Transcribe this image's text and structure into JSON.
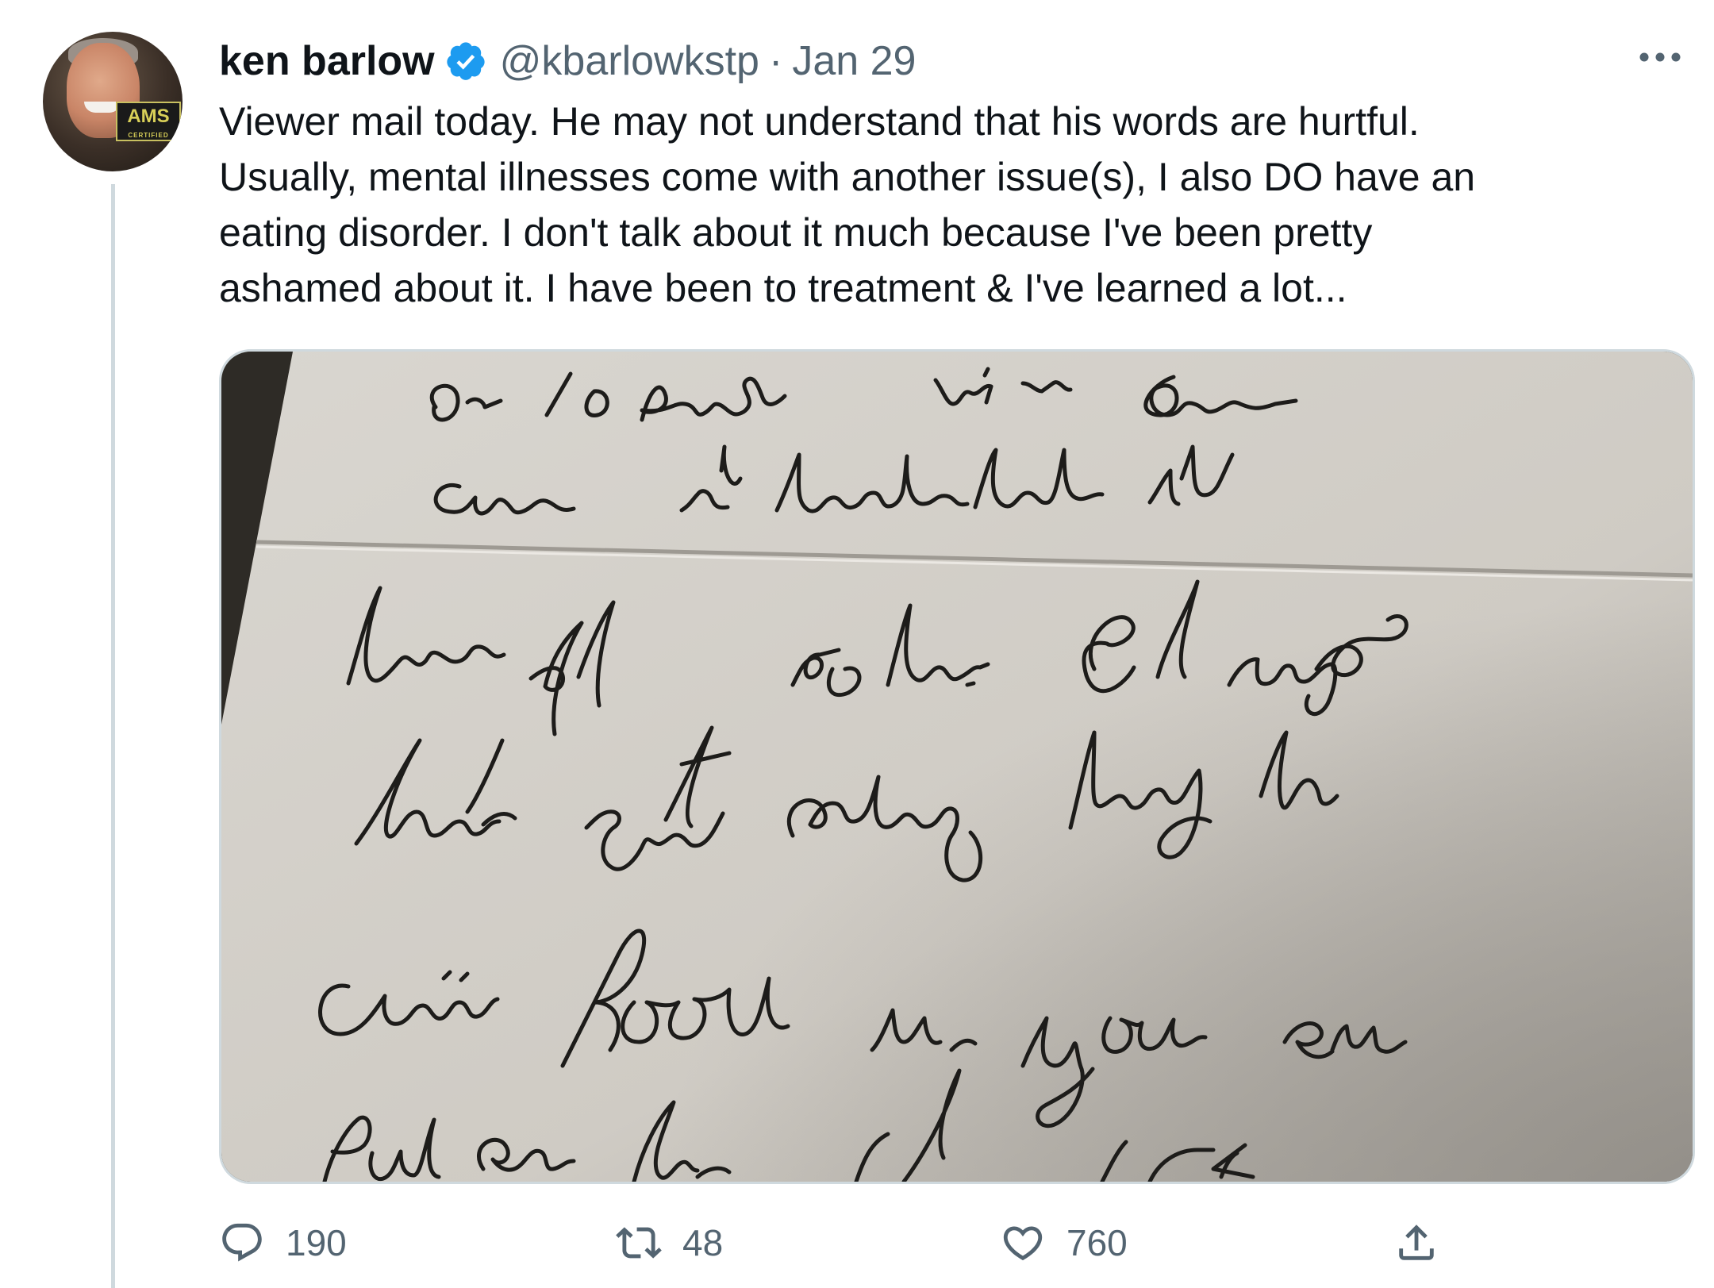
{
  "tweet": {
    "author": {
      "name": "ken barlow",
      "handle": "@kbarlowkstp",
      "avatar_badge": "AMS",
      "avatar_badge_sub": "CERTIFIED",
      "verified": true,
      "verified_color": "#1d9bf0"
    },
    "separator": "·",
    "date": "Jan 29",
    "more_icon": "more-horizontal-icon",
    "text_lines": [
      "Viewer mail today. He may not understand that his words are hurtful.",
      "Usually, mental illnesses come with another issue(s),  I also DO have an",
      "eating disorder. I don't talk about it much because I've been pretty",
      "ashamed about it. I have been to treatment & I've learned a lot..."
    ],
    "media": {
      "kind": "photo",
      "subject": "handwritten letter",
      "handwriting_lines": [
        "On 10 pounds but in your",
        "case it looks like it",
        "takes off 50 lbs. I suggest",
        "that you start eating high",
        "calorie foods so you can",
        "put on lbs"
      ]
    },
    "actions": {
      "reply": {
        "icon": "reply-icon",
        "count": "190"
      },
      "retweet": {
        "icon": "retweet-icon",
        "count": "48"
      },
      "like": {
        "icon": "heart-icon",
        "count": "760"
      },
      "share": {
        "icon": "share-icon"
      }
    },
    "colors": {
      "text": "#0f1419",
      "secondary": "#536471",
      "border": "#cfd9de",
      "accent": "#1d9bf0"
    }
  }
}
